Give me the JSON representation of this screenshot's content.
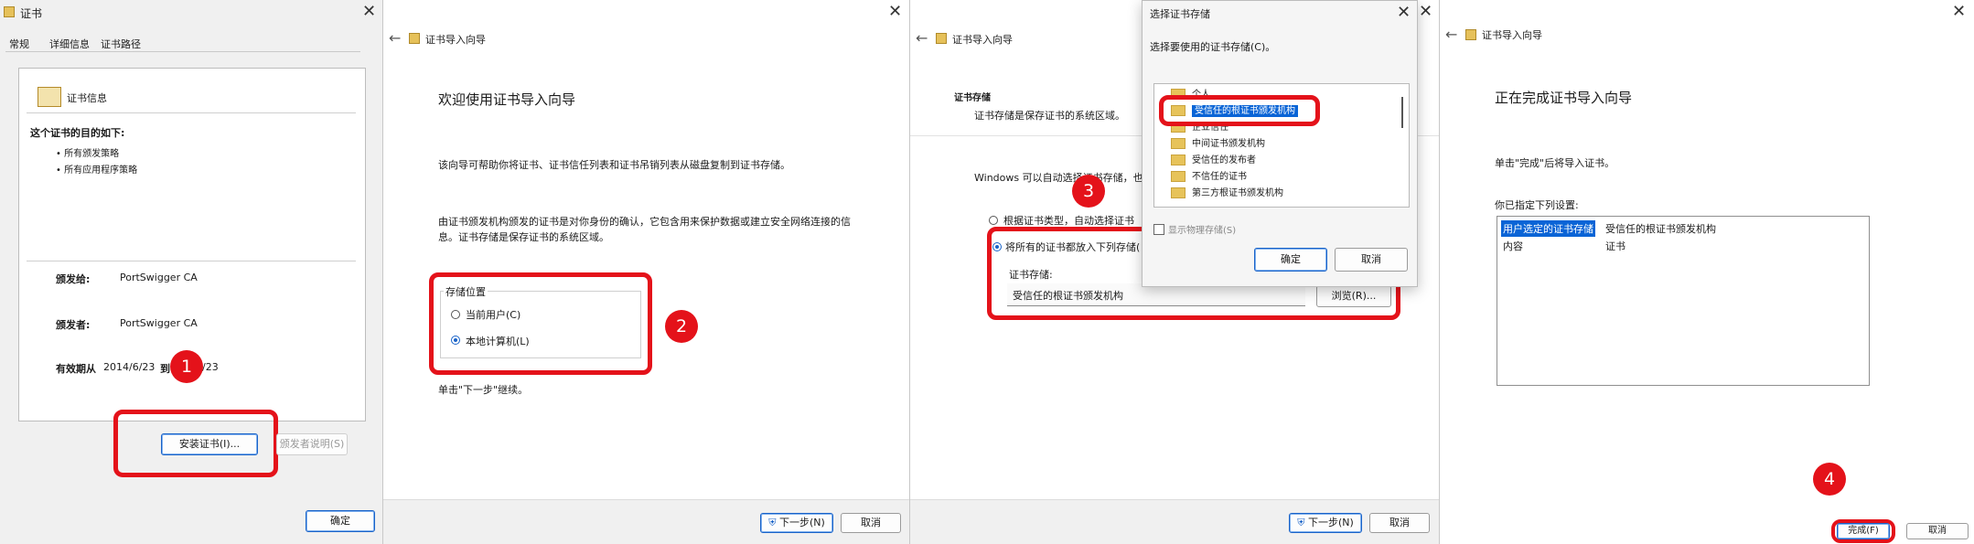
{
  "cert_dialog": {
    "title": "证书",
    "tabs": [
      "常规",
      "详细信息",
      "证书路径"
    ],
    "info_title": "证书信息",
    "purpose_heading": "这个证书的目的如下:",
    "purposes": [
      "• 所有颁发策略",
      "• 所有应用程序策略"
    ],
    "issued_to_label": "颁发给:",
    "issued_to_value": "PortSwigger CA",
    "issued_by_label": "颁发者:",
    "issued_by_value": "PortSwigger CA",
    "validity_label": "有效期从",
    "validity_from": "2014/6/23",
    "validity_to_word": "到",
    "validity_to": "/23",
    "install_button": "安装证书(I)...",
    "issuer_statement_button": "颁发者说明(S)",
    "ok_button": "确定"
  },
  "wizard1": {
    "title": "证书导入向导",
    "heading": "欢迎使用证书导入向导",
    "para1": "该向导可帮助你将证书、证书信任列表和证书吊销列表从磁盘复制到证书存储。",
    "para2_line1": "由证书颁发机构颁发的证书是对你身份的确认，它包含用来保护数据或建立安全网络连接的信",
    "para2_line2": "息。证书存储是保存证书的系统区域。",
    "store_location_label": "存储位置",
    "option_current_user": "当前用户(C)",
    "option_local_machine": "本地计算机(L)",
    "footer_hint": "单击\"下一步\"继续。",
    "next_button": "下一步(N)",
    "cancel_button": "取消"
  },
  "wizard2": {
    "title": "证书导入向导",
    "section_title": "证书存储",
    "section_desc": "证书存储是保存证书的系统区域。",
    "auto_text": "Windows 可以自动选择证书存储，也",
    "option_auto": "根据证书类型，自动选择证书",
    "option_manual": "将所有的证书都放入下列存储(",
    "store_label": "证书存储:",
    "store_value": "受信任的根证书颁发机构",
    "browse_button": "浏览(R)...",
    "next_button": "下一步(N)",
    "cancel_button": "取消"
  },
  "select_store": {
    "title": "选择证书存储",
    "prompt": "选择要使用的证书存储(C)。",
    "items": [
      "个人",
      "受信任的根证书颁发机构",
      "企业信任",
      "中间证书颁发机构",
      "受信任的发布者",
      "不信任的证书",
      "第三方根证书颁发机构"
    ],
    "selected_index": 1,
    "show_physical": "显示物理存储(S)",
    "ok_button": "确定",
    "cancel_button": "取消"
  },
  "wizard3": {
    "title": "证书导入向导",
    "heading": "正在完成证书导入向导",
    "para": "单击\"完成\"后将导入证书。",
    "settings_label": "你已指定下列设置:",
    "rows": [
      {
        "key": "用户选定的证书存储",
        "value": "受信任的根证书颁发机构"
      },
      {
        "key": "内容",
        "value": "证书"
      }
    ],
    "finish_button": "完成(F)",
    "cancel_button": "取消"
  },
  "badges": [
    "1",
    "2",
    "3",
    "4"
  ],
  "colors": {
    "annotation_red": "#e4121a",
    "selection_blue": "#0a64d6",
    "accent": "#1a63c8"
  }
}
